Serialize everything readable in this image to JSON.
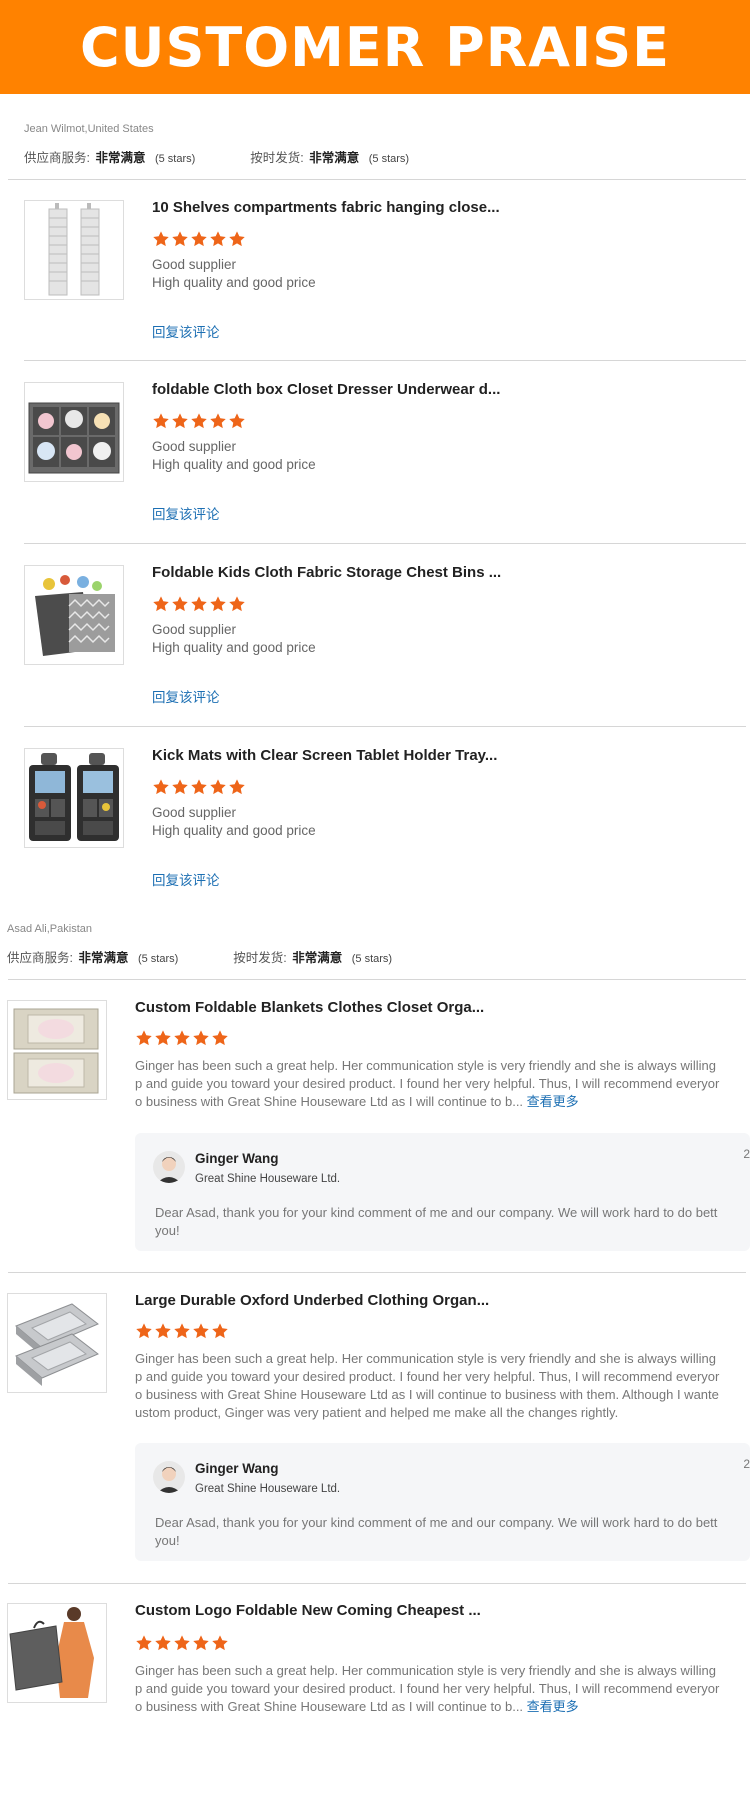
{
  "banner": {
    "title": "CUSTOMER PRAISE"
  },
  "colors": {
    "accent": "#ff8200",
    "star": "#ee6519",
    "link": "#1c6fb3"
  },
  "reviews": [
    {
      "reviewer": "Jean Wilmot,United States",
      "service_label": "供应商服务:",
      "service_value": "非常满意",
      "service_stars": "(5 stars)",
      "delivery_label": "按时发货:",
      "delivery_value": "非常满意",
      "delivery_stars": "(5 stars)",
      "products": [
        {
          "title": "10 Shelves compartments fabric hanging close...",
          "rating": 5,
          "line1": "Good supplier",
          "line2": "High quality and good price",
          "reply_link": "回复该评论",
          "image": "hanging-shelf"
        },
        {
          "title": "foldable Cloth box Closet Dresser Underwear d...",
          "rating": 5,
          "line1": "Good supplier",
          "line2": "High quality and good price",
          "reply_link": "回复该评论",
          "image": "drawer-organizer"
        },
        {
          "title": "Foldable Kids Cloth Fabric Storage Chest Bins ...",
          "rating": 5,
          "line1": "Good supplier",
          "line2": "High quality and good price",
          "reply_link": "回复该评论",
          "image": "toy-chest"
        },
        {
          "title": "Kick Mats with Clear Screen Tablet Holder Tray...",
          "rating": 5,
          "line1": "Good supplier",
          "line2": "High quality and good price",
          "reply_link": "回复该评论",
          "image": "car-seat-organizer"
        }
      ]
    },
    {
      "reviewer": "Asad Ali,Pakistan",
      "service_label": "供应商服务:",
      "service_value": "非常满意",
      "service_stars": "(5 stars)",
      "delivery_label": "按时发货:",
      "delivery_value": "非常满意",
      "delivery_stars": "(5 stars)",
      "products": [
        {
          "title": "Custom Foldable Blankets Clothes Closet Orga...",
          "rating": 5,
          "text_lines": [
            "Ginger has been such a great help. Her communication style is very friendly and she is always willing",
            "p and guide you toward your desired product. I found her very helpful. Thus, I will recommend everyor",
            "o business with Great Shine Houseware Ltd as I will continue to b..."
          ],
          "more_link": "查看更多",
          "image": "blanket-bag",
          "response": {
            "name": "Ginger Wang",
            "company": "Great Shine Houseware Ltd.",
            "date": "2",
            "lines": [
              "Dear Asad, thank you for your kind comment of me and our company. We will work hard to do bett",
              "you!"
            ]
          }
        },
        {
          "title": "Large Durable Oxford Underbed Clothing Organ...",
          "rating": 5,
          "text_lines": [
            "Ginger has been such a great help. Her communication style is very friendly and she is always willing",
            "p and guide you toward your desired product. I found her very helpful. Thus, I will recommend everyor",
            "o business with Great Shine Houseware Ltd as I will continue to business with them. Although I wante",
            "ustom product, Ginger was very patient and helped me make all the changes rightly."
          ],
          "more_link": "",
          "image": "underbed-bag",
          "response": {
            "name": "Ginger Wang",
            "company": "Great Shine Houseware Ltd.",
            "date": "2",
            "lines": [
              "Dear Asad, thank you for your kind comment of me and our company. We will work hard to do bett",
              "you!"
            ]
          }
        },
        {
          "title": "Custom Logo Foldable New Coming Cheapest ...",
          "rating": 5,
          "text_lines": [
            "Ginger has been such a great help. Her communication style is very friendly and she is always willing",
            "p and guide you toward your desired product. I found her very helpful. Thus, I will recommend everyor",
            "o business with Great Shine Houseware Ltd as I will continue to b..."
          ],
          "more_link": "查看更多",
          "image": "garment-bag"
        }
      ]
    }
  ]
}
